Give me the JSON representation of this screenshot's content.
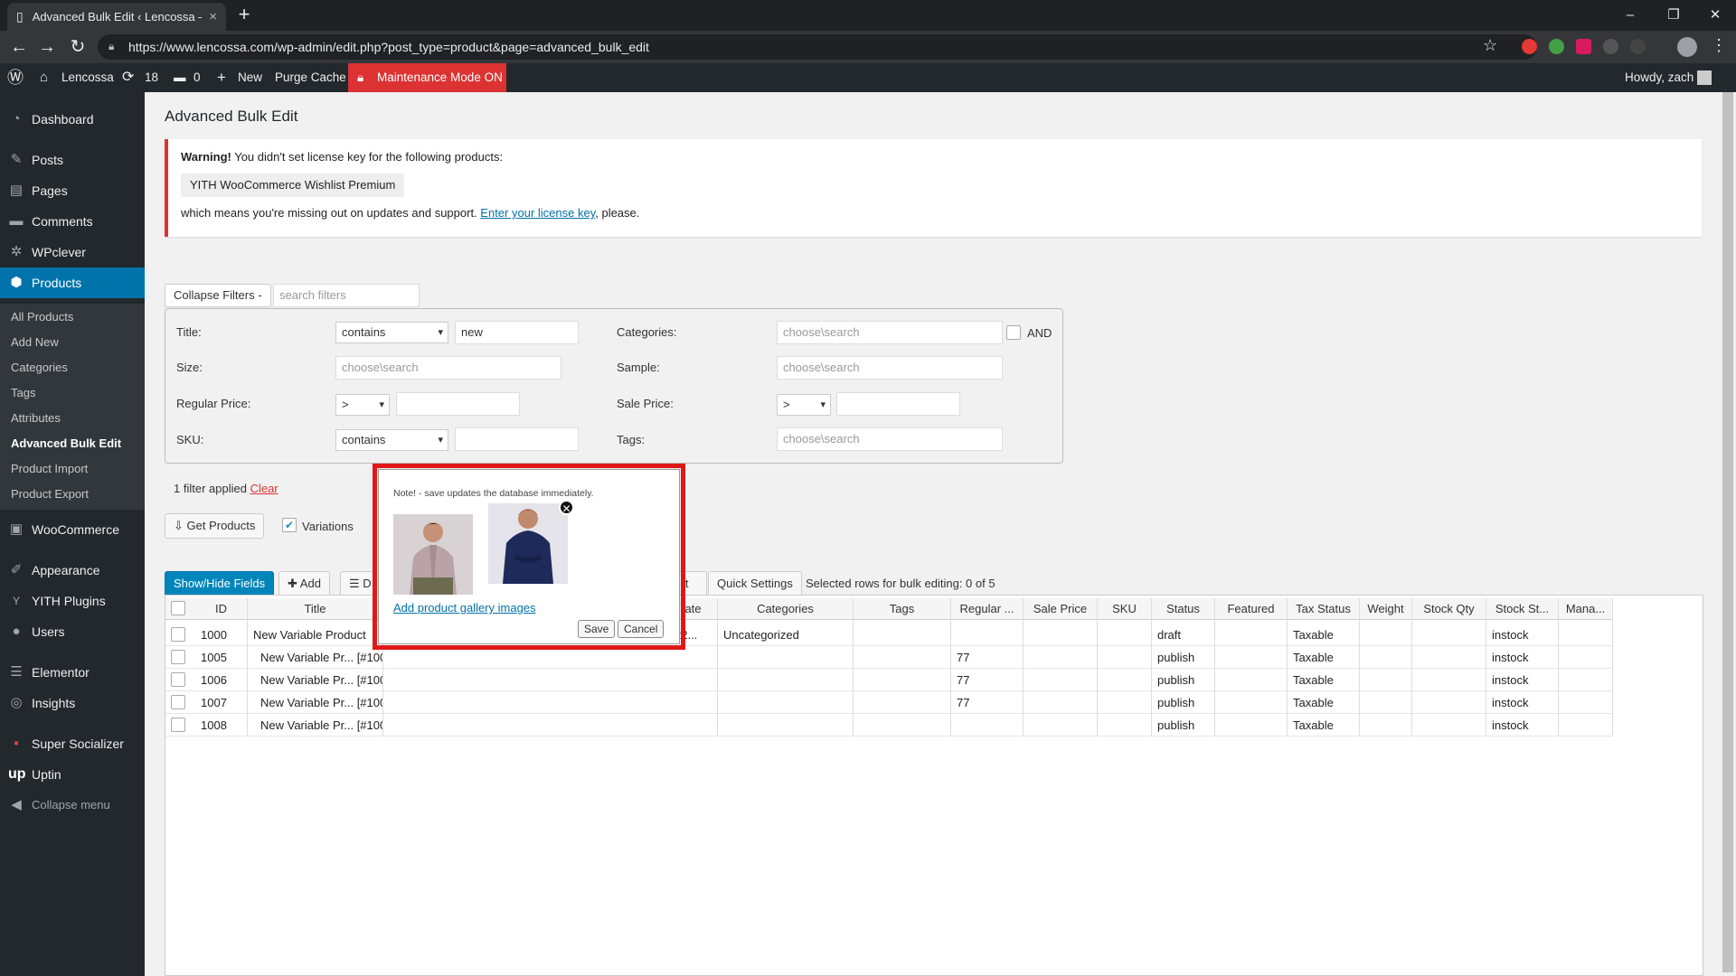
{
  "browser": {
    "tab_title": "Advanced Bulk Edit ‹ Lencossa —",
    "url": "https://www.lencossa.com/wp-admin/edit.php?post_type=product&page=advanced_bulk_edit"
  },
  "adminbar": {
    "site": "Lencossa",
    "updates": "18",
    "comments": "0",
    "new": "New",
    "purge": "Purge Cache",
    "maintenance": "Maintenance Mode ON",
    "howdy": "Howdy, zach"
  },
  "sidebar": {
    "items": [
      {
        "label": "Dashboard",
        "icon": "dashboard-icon"
      },
      {
        "label": "Posts",
        "icon": "pin-icon"
      },
      {
        "label": "Pages",
        "icon": "pages-icon"
      },
      {
        "label": "Comments",
        "icon": "comment-icon"
      },
      {
        "label": "WPclever",
        "icon": "gear-icon"
      },
      {
        "label": "Products",
        "icon": "box-icon"
      },
      {
        "label": "WooCommerce",
        "icon": "woo-icon"
      },
      {
        "label": "Appearance",
        "icon": "brush-icon"
      },
      {
        "label": "YITH Plugins",
        "icon": "yith-icon"
      },
      {
        "label": "Users",
        "icon": "user-icon"
      },
      {
        "label": "Elementor",
        "icon": "elementor-icon"
      },
      {
        "label": "Insights",
        "icon": "insights-icon"
      },
      {
        "label": "Super Socializer",
        "icon": "socializer-icon"
      },
      {
        "label": "Uptin",
        "icon": "uptin-icon"
      },
      {
        "label": "Collapse menu",
        "icon": "collapse-icon"
      }
    ],
    "submenu": [
      "All Products",
      "Add New",
      "Categories",
      "Tags",
      "Attributes",
      "Advanced Bulk Edit",
      "Product Import",
      "Product Export"
    ]
  },
  "page": {
    "title": "Advanced Bulk Edit",
    "notice_bold": "Warning!",
    "notice_text": " You didn't set license key for the following products:",
    "notice_product": "YITH WooCommerce Wishlist Premium",
    "notice_l3_pre": "which means you're missing out on updates and support. ",
    "notice_link": "Enter your license key",
    "notice_l3_post": ", please."
  },
  "filters": {
    "collapse": "Collapse Filters -",
    "search_placeholder": "search filters",
    "title_label": "Title:",
    "title_op": "contains",
    "title_value": "new",
    "categories_label": "Categories:",
    "choose": "choose\\search",
    "and_label": "AND",
    "size_label": "Size:",
    "sample_label": "Sample:",
    "regular_label": "Regular Price:",
    "regular_op": ">",
    "sale_label": "Sale Price:",
    "sale_op": ">",
    "sku_label": "SKU:",
    "sku_op": "contains",
    "tags_label": "Tags:",
    "applied": "1 filter applied ",
    "clear": "Clear",
    "get_products": "Get Products",
    "variations": "Variations"
  },
  "toolbar": {
    "show_hide": "Show/Hide Fields",
    "add": "Add",
    "d": "D",
    "edit_tail": "it",
    "quick_settings": "Quick Settings",
    "selected": "Selected rows for bulk editing:  0 of 5"
  },
  "table": {
    "headers": [
      "ID",
      "Title",
      "ate",
      "Categories",
      "Tags",
      "Regular ...",
      "Sale Price",
      "SKU",
      "Status",
      "Featured",
      "Tax Status",
      "Weight",
      "Stock Qty",
      "Stock St...",
      "Mana..."
    ],
    "rows": [
      {
        "id": "1000",
        "title": "New Variable Product",
        "date": "22...",
        "categories": "Uncategorized",
        "regular": "",
        "status": "draft",
        "tax": "Taxable",
        "stock": "instock"
      },
      {
        "id": "1005",
        "title": "New Variable Pr... [#1000 var] (S)",
        "date": "",
        "categories": "",
        "regular": "77",
        "status": "publish",
        "tax": "Taxable",
        "stock": "instock"
      },
      {
        "id": "1006",
        "title": "New Variable Pr... [#1000 var] (M)",
        "date": "",
        "categories": "",
        "regular": "77",
        "status": "publish",
        "tax": "Taxable",
        "stock": "instock"
      },
      {
        "id": "1007",
        "title": "New Variable Pr... [#1000 var] (L)",
        "date": "",
        "categories": "",
        "regular": "77",
        "status": "publish",
        "tax": "Taxable",
        "stock": "instock"
      },
      {
        "id": "1008",
        "title": "New Variable Pr... [#1000 var] (X...",
        "date": "",
        "categories": "",
        "regular": "",
        "status": "publish",
        "tax": "Taxable",
        "stock": "instock"
      }
    ]
  },
  "popup": {
    "note": "Note! - save updates the database immediately.",
    "add_gallery": "Add product gallery images",
    "save": "Save",
    "cancel": "Cancel"
  },
  "colors": {
    "accent": "#0073aa",
    "danger": "#dc3232",
    "highlight": "#e01818"
  }
}
